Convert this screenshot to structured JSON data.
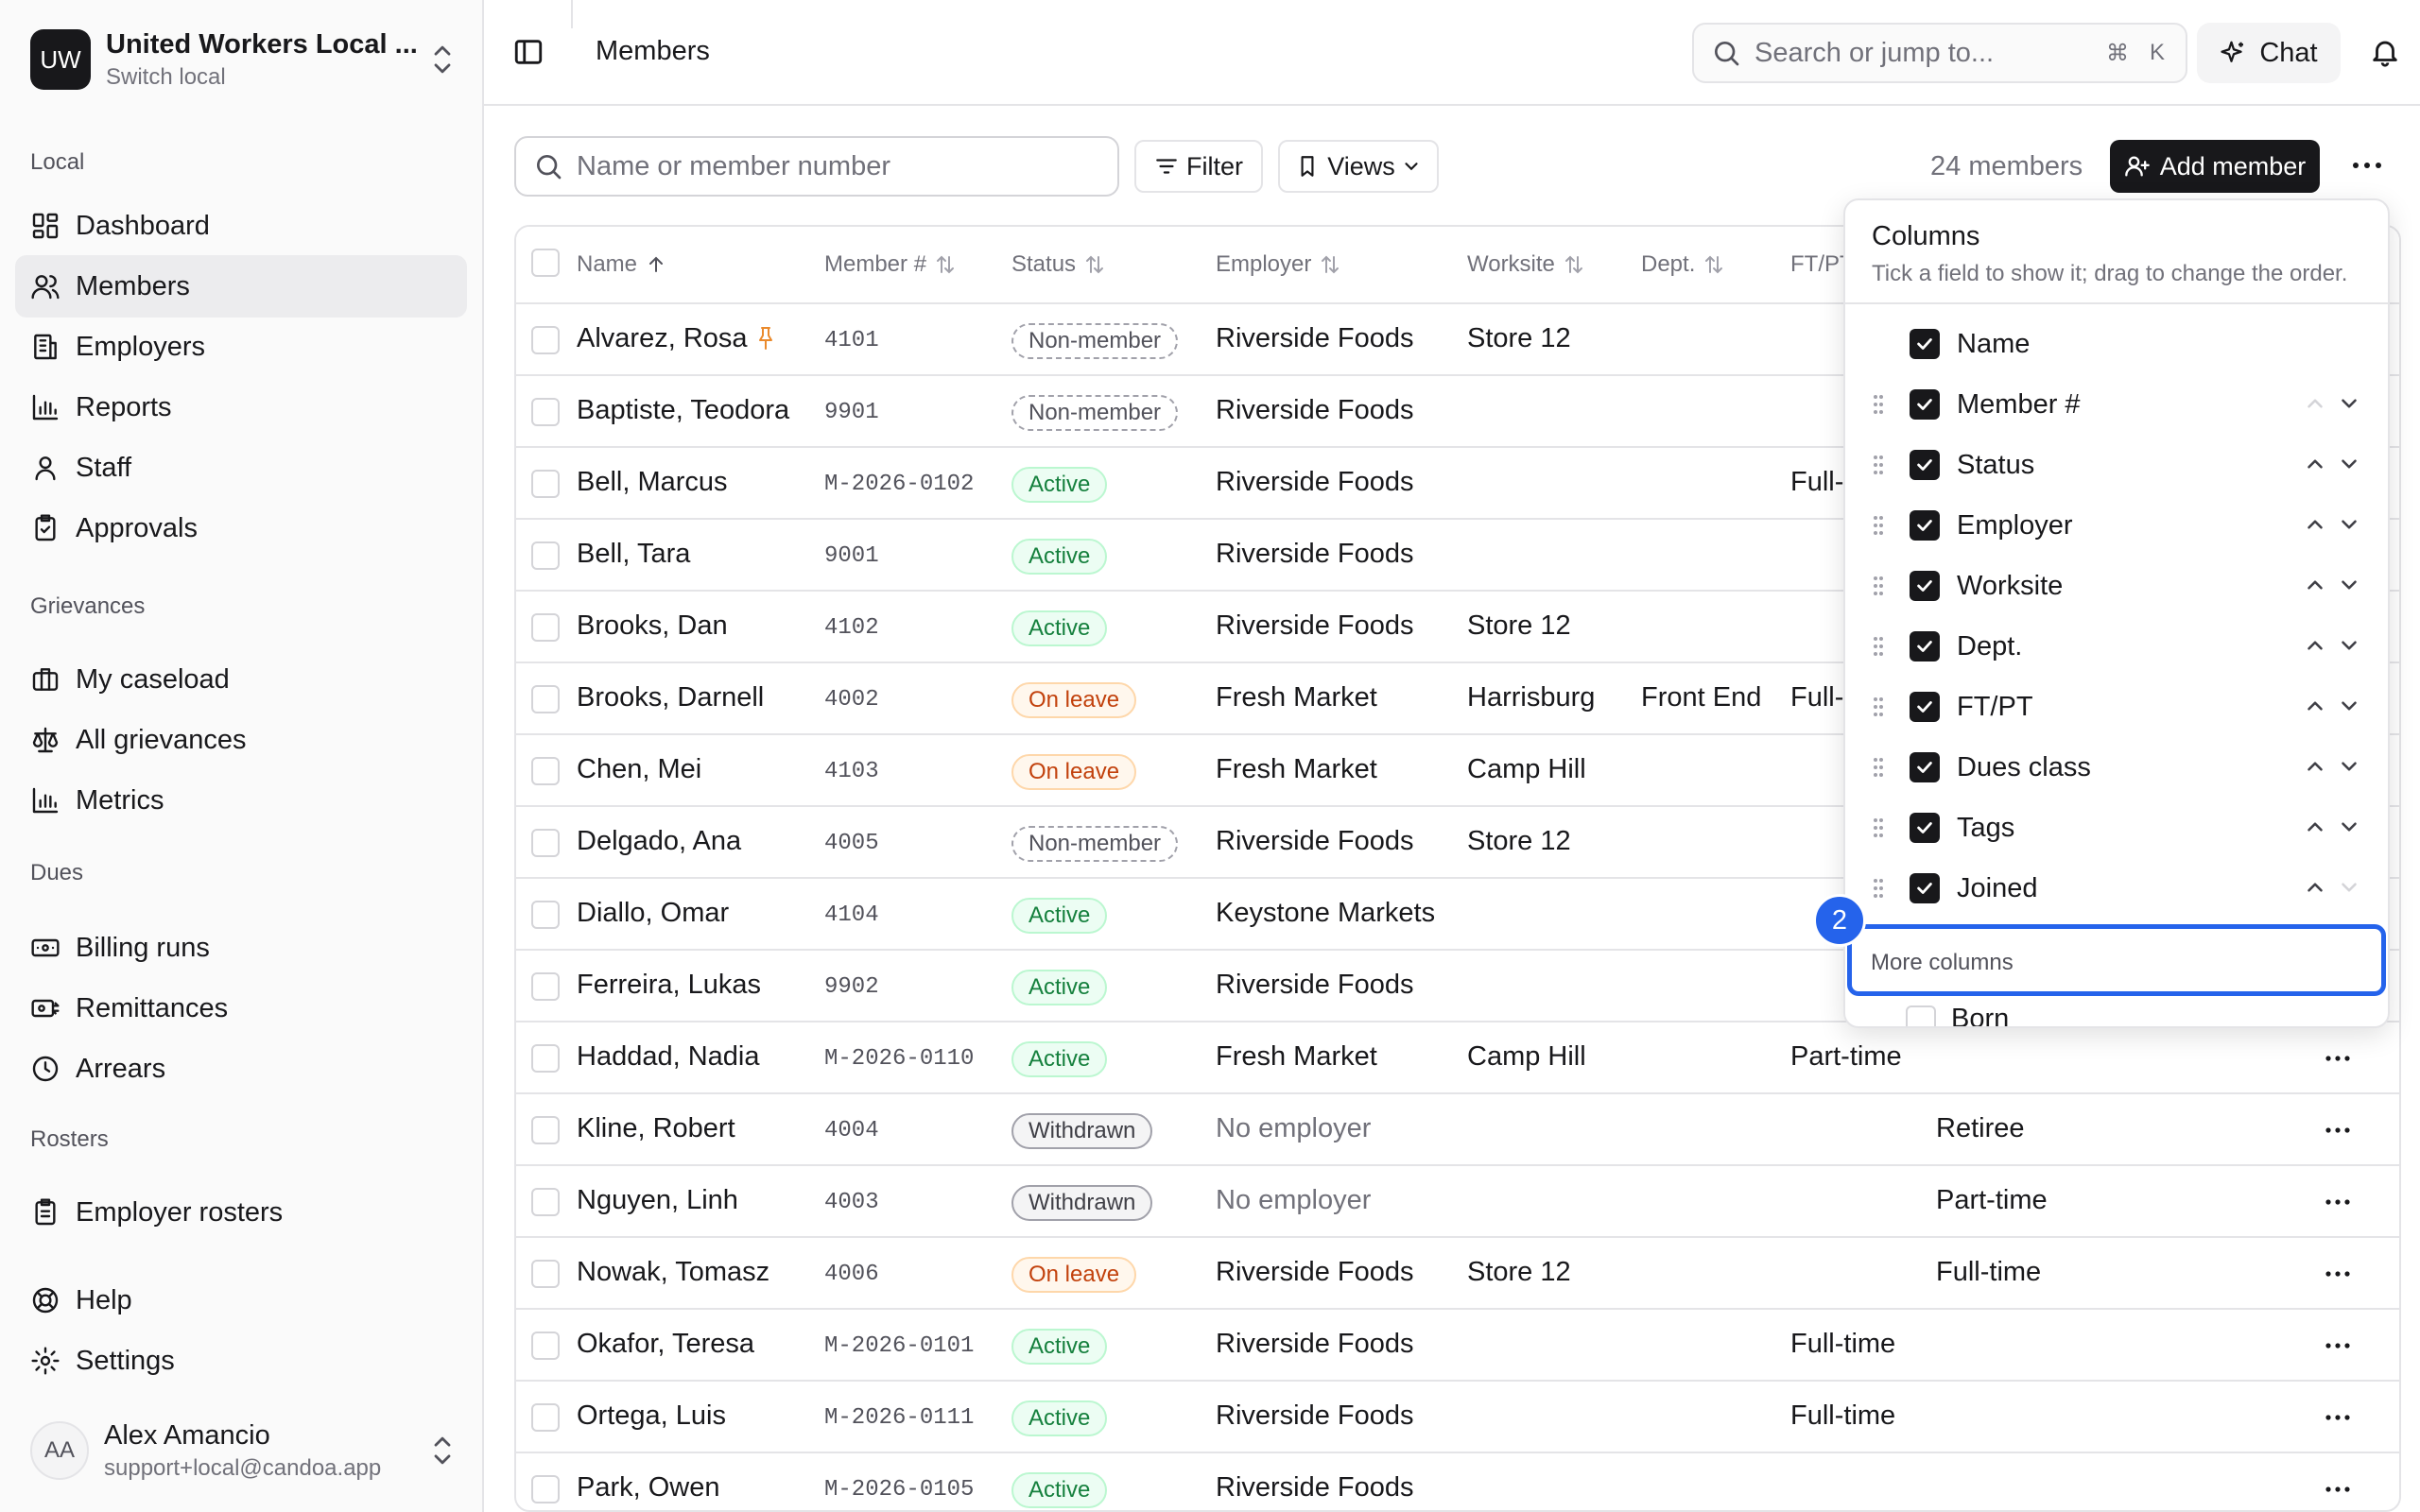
{
  "workspace": {
    "initials": "UW",
    "name": "United Workers Local ...",
    "subtitle": "Switch local"
  },
  "sidebar": {
    "sections": [
      {
        "label": "Local",
        "items": [
          {
            "label": "Dashboard",
            "icon": "dashboard-icon"
          },
          {
            "label": "Members",
            "icon": "users-icon",
            "active": true
          },
          {
            "label": "Employers",
            "icon": "building-icon"
          },
          {
            "label": "Reports",
            "icon": "bar-chart-icon"
          },
          {
            "label": "Staff",
            "icon": "user-icon"
          },
          {
            "label": "Approvals",
            "icon": "clipboard-check-icon"
          }
        ]
      },
      {
        "label": "Grievances",
        "items": [
          {
            "label": "My caseload",
            "icon": "briefcase-icon"
          },
          {
            "label": "All grievances",
            "icon": "scale-icon"
          },
          {
            "label": "Metrics",
            "icon": "bar-chart-icon"
          }
        ]
      },
      {
        "label": "Dues",
        "items": [
          {
            "label": "Billing runs",
            "icon": "banknote-icon"
          },
          {
            "label": "Remittances",
            "icon": "remittance-icon"
          },
          {
            "label": "Arrears",
            "icon": "clock-icon"
          }
        ]
      },
      {
        "label": "Rosters",
        "items": [
          {
            "label": "Employer rosters",
            "icon": "clipboard-list-icon"
          }
        ]
      }
    ],
    "footer_items": [
      {
        "label": "Help",
        "icon": "lifebuoy-icon"
      },
      {
        "label": "Settings",
        "icon": "gear-icon"
      }
    ],
    "user": {
      "initials": "AA",
      "name": "Alex Amancio",
      "email": "support+local@candoa.app"
    }
  },
  "topbar": {
    "title": "Members",
    "search_placeholder": "Search or jump to...",
    "shortcut_cmd": "⌘",
    "shortcut_key": "K",
    "chat_label": "Chat"
  },
  "toolbar": {
    "search_placeholder": "Name or member number",
    "filter_label": "Filter",
    "views_label": "Views",
    "count": "24 members",
    "add_label": "Add member"
  },
  "table": {
    "headers": {
      "name": "Name",
      "member": "Member #",
      "status": "Status",
      "employer": "Employer",
      "worksite": "Worksite",
      "dept": "Dept.",
      "ftpt": "FT/PT"
    },
    "rows": [
      {
        "name": "Alvarez, Rosa",
        "member": "4101",
        "status": "Non-member",
        "status_kind": "non",
        "employer": "Riverside Foods",
        "worksite": "Store 12",
        "dept": "",
        "ftpt": "",
        "dues": "",
        "pinned": true
      },
      {
        "name": "Baptiste, Teodora",
        "member": "9901",
        "status": "Non-member",
        "status_kind": "non",
        "employer": "Riverside Foods",
        "worksite": "",
        "dept": "",
        "ftpt": "",
        "dues": ""
      },
      {
        "name": "Bell, Marcus",
        "member": "M-2026-0102",
        "status": "Active",
        "status_kind": "active",
        "employer": "Riverside Foods",
        "worksite": "",
        "dept": "",
        "ftpt": "Full-",
        "dues": ""
      },
      {
        "name": "Bell, Tara",
        "member": "9001",
        "status": "Active",
        "status_kind": "active",
        "employer": "Riverside Foods",
        "worksite": "",
        "dept": "",
        "ftpt": "",
        "dues": ""
      },
      {
        "name": "Brooks, Dan",
        "member": "4102",
        "status": "Active",
        "status_kind": "active",
        "employer": "Riverside Foods",
        "worksite": "Store 12",
        "dept": "",
        "ftpt": "",
        "dues": ""
      },
      {
        "name": "Brooks, Darnell",
        "member": "4002",
        "status": "On leave",
        "status_kind": "leave",
        "employer": "Fresh Market",
        "worksite": "Harrisburg",
        "dept": "Front End",
        "ftpt": "Full-",
        "dues": ""
      },
      {
        "name": "Chen, Mei",
        "member": "4103",
        "status": "On leave",
        "status_kind": "leave",
        "employer": "Fresh Market",
        "worksite": "Camp Hill",
        "dept": "",
        "ftpt": "",
        "dues": ""
      },
      {
        "name": "Delgado, Ana",
        "member": "4005",
        "status": "Non-member",
        "status_kind": "non",
        "employer": "Riverside Foods",
        "worksite": "Store 12",
        "dept": "",
        "ftpt": "",
        "dues": ""
      },
      {
        "name": "Diallo, Omar",
        "member": "4104",
        "status": "Active",
        "status_kind": "active",
        "employer": "Keystone Markets",
        "worksite": "",
        "dept": "",
        "ftpt": "",
        "dues": ""
      },
      {
        "name": "Ferreira, Lukas",
        "member": "9902",
        "status": "Active",
        "status_kind": "active",
        "employer": "Riverside Foods",
        "worksite": "",
        "dept": "",
        "ftpt": "",
        "dues": ""
      },
      {
        "name": "Haddad, Nadia",
        "member": "M-2026-0110",
        "status": "Active",
        "status_kind": "active",
        "employer": "Fresh Market",
        "worksite": "Camp Hill",
        "dept": "",
        "ftpt": "Part-time",
        "dues": "",
        "more": true
      },
      {
        "name": "Kline, Robert",
        "member": "4004",
        "status": "Withdrawn",
        "status_kind": "wd",
        "employer": "No employer",
        "employer_muted": true,
        "worksite": "",
        "dept": "",
        "ftpt": "",
        "dues": "Retiree",
        "more": true
      },
      {
        "name": "Nguyen, Linh",
        "member": "4003",
        "status": "Withdrawn",
        "status_kind": "wd",
        "employer": "No employer",
        "employer_muted": true,
        "worksite": "",
        "dept": "",
        "ftpt": "",
        "dues": "Part-time",
        "more": true
      },
      {
        "name": "Nowak, Tomasz",
        "member": "4006",
        "status": "On leave",
        "status_kind": "leave",
        "employer": "Riverside Foods",
        "worksite": "Store 12",
        "dept": "",
        "ftpt": "",
        "dues": "Full-time",
        "more": true
      },
      {
        "name": "Okafor, Teresa",
        "member": "M-2026-0101",
        "status": "Active",
        "status_kind": "active",
        "employer": "Riverside Foods",
        "worksite": "",
        "dept": "",
        "ftpt": "Full-time",
        "dues": "",
        "more": true
      },
      {
        "name": "Ortega, Luis",
        "member": "M-2026-0111",
        "status": "Active",
        "status_kind": "active",
        "employer": "Riverside Foods",
        "worksite": "",
        "dept": "",
        "ftpt": "Full-time",
        "dues": "",
        "more": true
      },
      {
        "name": "Park, Owen",
        "member": "M-2026-0105",
        "status": "Active",
        "status_kind": "active",
        "employer": "Riverside Foods",
        "worksite": "",
        "dept": "",
        "ftpt": "",
        "dues": "",
        "more": true
      }
    ]
  },
  "columns_panel": {
    "title": "Columns",
    "subtitle": "Tick a field to show it; drag to change the order.",
    "items": [
      {
        "label": "Name",
        "checked": true,
        "fixed": true
      },
      {
        "label": "Member #",
        "checked": true,
        "up_disabled": true
      },
      {
        "label": "Status",
        "checked": true
      },
      {
        "label": "Employer",
        "checked": true
      },
      {
        "label": "Worksite",
        "checked": true
      },
      {
        "label": "Dept.",
        "checked": true
      },
      {
        "label": "FT/PT",
        "checked": true
      },
      {
        "label": "Dues class",
        "checked": true
      },
      {
        "label": "Tags",
        "checked": true
      },
      {
        "label": "Joined",
        "checked": true,
        "down_disabled": true
      }
    ],
    "more_label": "More columns",
    "extra": [
      {
        "label": "Born",
        "checked": false
      }
    ]
  },
  "step_marker": "2"
}
